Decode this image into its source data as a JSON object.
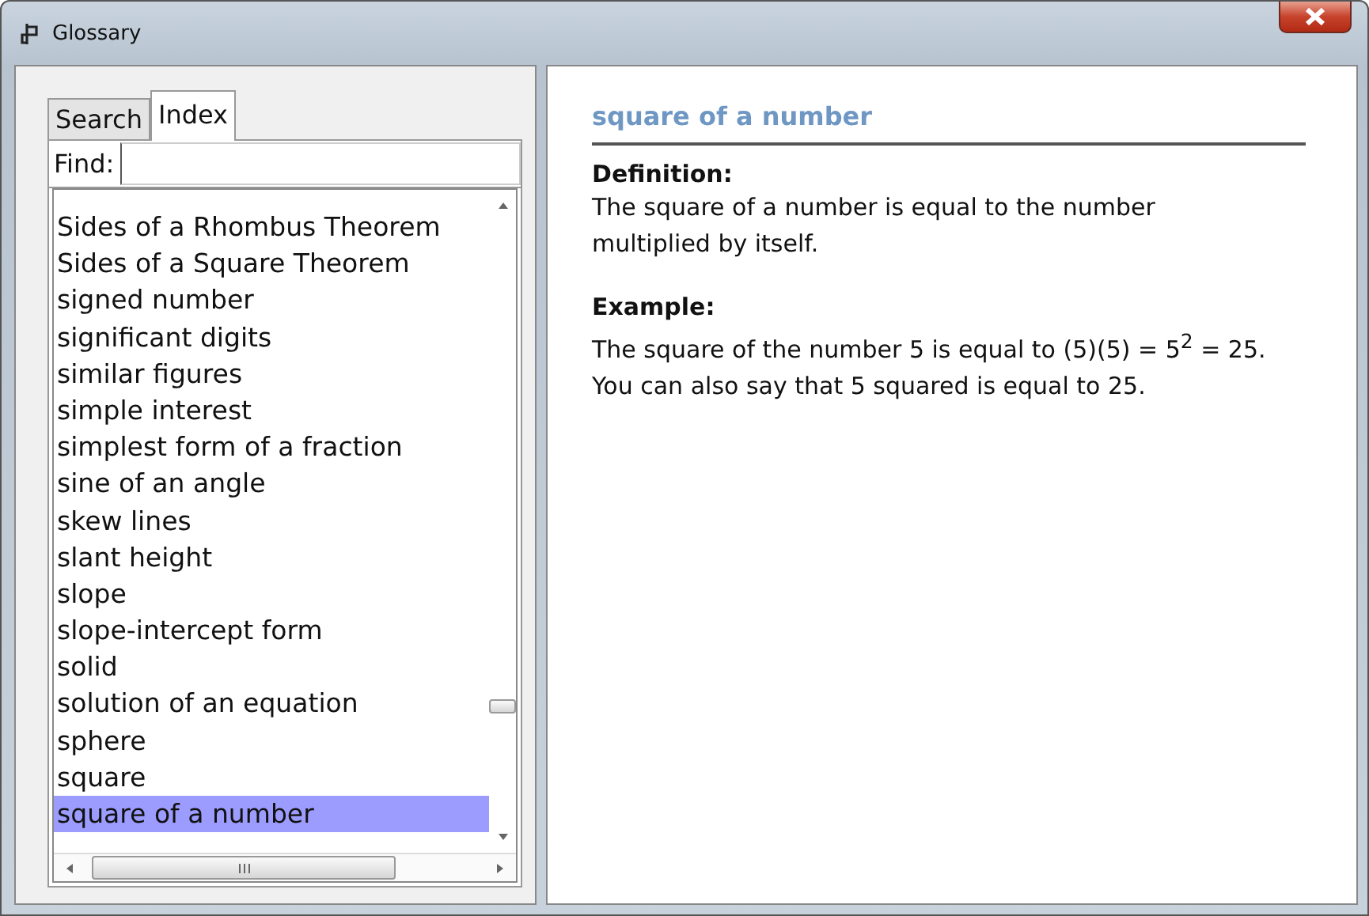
{
  "window": {
    "title": "Glossary"
  },
  "tabs": [
    {
      "label": "Search",
      "selected": false
    },
    {
      "label": "Index",
      "selected": true
    }
  ],
  "find": {
    "label": "Find:"
  },
  "index": [
    {
      "label": "Sides of a Rhombus Theorem",
      "selected": false
    },
    {
      "label": "Sides of a Square Theorem",
      "selected": false
    },
    {
      "label": "signed number",
      "selected": false
    },
    {
      "label": "significant digits",
      "selected": false
    },
    {
      "label": "similar figures",
      "selected": false
    },
    {
      "label": "simple interest",
      "selected": false
    },
    {
      "label": "simplest form of a fraction",
      "selected": false
    },
    {
      "label": "sine of an angle",
      "selected": false
    },
    {
      "label": "skew lines",
      "selected": false
    },
    {
      "label": "slant height",
      "selected": false
    },
    {
      "label": "slope",
      "selected": false
    },
    {
      "label": "slope-intercept form",
      "selected": false
    },
    {
      "label": "solid",
      "selected": false
    },
    {
      "label": "solution of an equation",
      "selected": false
    },
    {
      "label": "sphere",
      "selected": false
    },
    {
      "label": "square",
      "selected": false
    },
    {
      "label": "square of a number",
      "selected": true
    }
  ],
  "entry": {
    "term": "square of a number",
    "sections": [
      {
        "heading": "Definition:",
        "text": "The square of a number is equal to the number multiplied by itself."
      },
      {
        "heading": "Example:",
        "text": "The square of the number 5 is equal to (5)(5) = 5$^{2}$ = 25. You can also say that 5 squared is equal to 25."
      }
    ]
  }
}
